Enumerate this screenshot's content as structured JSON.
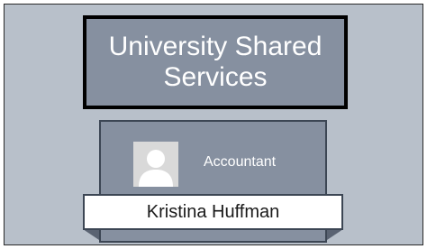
{
  "org_chart": {
    "title": "University Shared Services",
    "card": {
      "role": "Accountant",
      "name": "Kristina Huffman",
      "avatar_icon": "person-silhouette-icon"
    }
  },
  "colors": {
    "background": "#b8c0ca",
    "box_fill": "#8690a0",
    "title_border": "#000000",
    "banner_fill": "#ffffff"
  }
}
